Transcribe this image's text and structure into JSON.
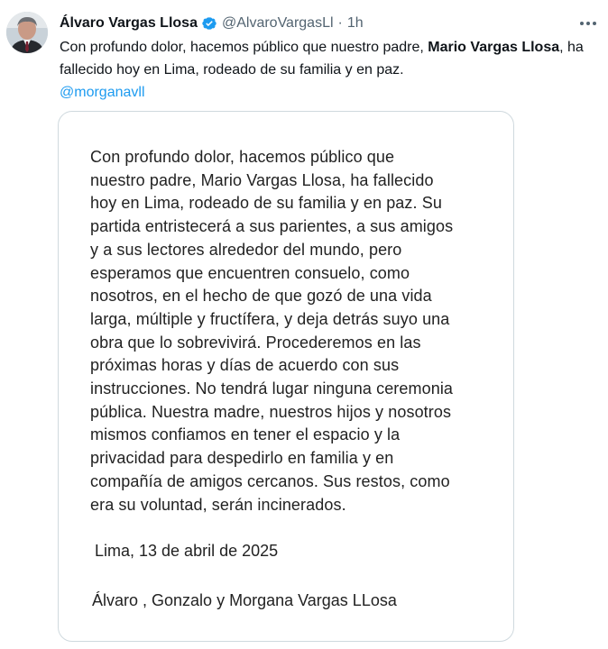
{
  "tweet": {
    "author_name": "Álvaro Vargas Llosa",
    "handle": "@AlvaroVargasLl",
    "separator": "·",
    "time": "1h",
    "text_part1": "Con profundo dolor, hacemos público que nuestro padre, ",
    "text_bold": "Mario Vargas Llosa",
    "text_part2": ", ha fallecido hoy en Lima, rodeado de su familia y en paz.",
    "mention": "@morganavll",
    "icons": {
      "verified": "verified-badge-icon",
      "more": "more-options-icon"
    },
    "colors": {
      "link": "#1d9bf0",
      "secondary_text": "#536471",
      "verified": "#1d9bf0"
    }
  },
  "letter": {
    "lines": [
      "Con profundo dolor,  hacemos público que",
      "nuestro padre, Mario Vargas Llosa, ha fallecido",
      "hoy en Lima, rodeado de su familia y en paz. Su",
      "partida entristecerá a sus parientes, a sus amigos",
      "y a sus lectores alrededor del mundo, pero",
      "esperamos que encuentren consuelo, como",
      "nosotros, en el hecho de que gozó de una vida",
      "larga, múltiple y fructífera, y deja detrás suyo una",
      "obra que lo sobrevivirá. Procederemos en las",
      "próximas horas y días de acuerdo con sus",
      "instrucciones. No tendrá lugar ninguna ceremonia",
      "pública. Nuestra madre, nuestros hijos y nosotros",
      "mismos confiamos en tener el espacio y la",
      "privacidad para despedirlo en familia y en",
      "compañía de amigos cercanos. Sus restos, como",
      "era su voluntad, serán incinerados."
    ],
    "date": "Lima, 13 de abril de 2025",
    "signature": "Álvaro , Gonzalo y Morgana Vargas LLosa"
  }
}
